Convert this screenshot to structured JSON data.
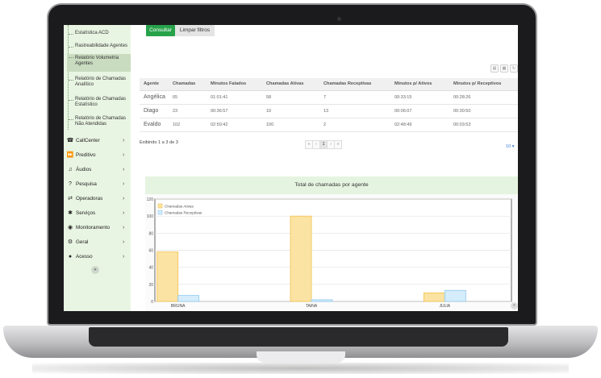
{
  "sidebar": {
    "sub_items": [
      {
        "label": "Estatística ACD"
      },
      {
        "label": "Rastreabilidade Agentes"
      },
      {
        "label": "Relatório Volumetria Agentes"
      },
      {
        "label": "Relatório de Chamadas Analítico"
      },
      {
        "label": "Relatório de Chamadas Estatístico"
      },
      {
        "label": "Relatório de Chamadas Não Atendidas"
      }
    ],
    "menu": [
      {
        "label": "CallCenter",
        "icon": "headset-icon",
        "glyph": "☎"
      },
      {
        "label": "Preditivo",
        "icon": "fast-forward-icon",
        "glyph": "⏩"
      },
      {
        "label": "Áudios",
        "icon": "music-icon",
        "glyph": "♫"
      },
      {
        "label": "Pesquisa",
        "icon": "question-icon",
        "glyph": "?"
      },
      {
        "label": "Operadoras",
        "icon": "plug-icon",
        "glyph": "⇄"
      },
      {
        "label": "Serviços",
        "icon": "asterisk-icon",
        "glyph": "✱"
      },
      {
        "label": "Monitoramento",
        "icon": "eye-icon",
        "glyph": "◉"
      },
      {
        "label": "Geral",
        "icon": "gears-icon",
        "glyph": "⚙"
      },
      {
        "label": "Acesso",
        "icon": "user-icon",
        "glyph": "●"
      }
    ],
    "collapse_glyph": "«"
  },
  "toolbar": {
    "consultar_label": "Consultar",
    "limpar_label": "Limpar filtros"
  },
  "table": {
    "headers": [
      "Agente",
      "Chamadas",
      "Minutos Falados",
      "Chamadas Ativas",
      "Chamadas Receptivas",
      "Minutos p/ Ativos",
      "Minutos p/ Receptivos"
    ],
    "rows": [
      [
        "Angélica",
        "65",
        "01:01:41",
        "58",
        "7",
        "00:33:15",
        "00:28:26"
      ],
      [
        "Diago",
        "23",
        "00:36:57",
        "10",
        "13",
        "00:06:07",
        "00:30:50"
      ],
      [
        "Evaldo",
        "102",
        "02:50:42",
        "100",
        "2",
        "02:48:49",
        "00:03:53"
      ]
    ]
  },
  "info_text": "Exibindo 1 a 3 de 3",
  "pager": {
    "first": "«",
    "prev": "‹",
    "current": "1",
    "next": "›",
    "last": "»"
  },
  "page_size": "10 ▾",
  "chart_data": {
    "type": "bar",
    "title": "Total de chamadas por agente",
    "categories": [
      "BRUNA",
      "TAINA",
      "JULIA"
    ],
    "series": [
      {
        "name": "Chamadas Ativas",
        "values": [
          58,
          100,
          10
        ],
        "color": "#fbe3a3",
        "stroke": "#f2c24a"
      },
      {
        "name": "Chamadas Receptivas",
        "values": [
          7,
          2,
          13
        ],
        "color": "#d5ecfb",
        "stroke": "#8ec9ef"
      }
    ],
    "yticks": [
      0,
      20,
      40,
      60,
      80,
      100,
      120
    ],
    "ylim": [
      0,
      120
    ],
    "grid": true,
    "legend": "top-left"
  },
  "colors": {
    "accent": "#27a24a",
    "sidebar_bg": "#e9f5e3"
  }
}
